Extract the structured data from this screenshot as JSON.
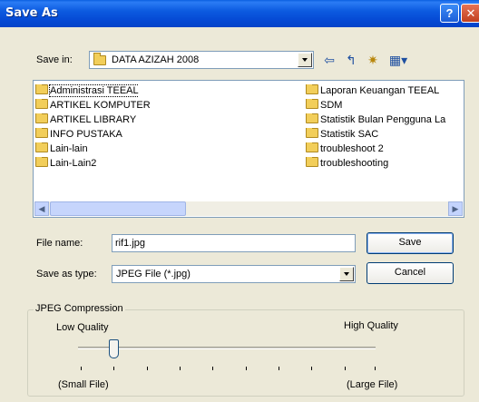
{
  "window": {
    "title": "Save As"
  },
  "titlebar_buttons": {
    "help": "?",
    "close": "✕"
  },
  "save_in": {
    "label": "Save in:",
    "value": "DATA AZIZAH 2008"
  },
  "toolbar": {
    "back": "⇦",
    "up": "↰",
    "new_folder": "✷",
    "view": "▦▾"
  },
  "files": {
    "left": [
      "Administrasi TEEAL",
      "ARTIKEL KOMPUTER",
      "ARTIKEL LIBRARY",
      "INFO PUSTAKA",
      "Lain-lain",
      "Lain-Lain2"
    ],
    "right": [
      "Laporan Keuangan TEEAL",
      "SDM",
      "Statistik Bulan Pengguna La",
      "Statistik SAC",
      "troubleshoot 2",
      "troubleshooting"
    ]
  },
  "file_name": {
    "label": "File name:",
    "value": "rif1.jpg"
  },
  "save_as_type": {
    "label": "Save as type:",
    "value": "JPEG File (*.jpg)"
  },
  "buttons": {
    "save": "Save",
    "cancel": "Cancel"
  },
  "jpeg": {
    "title": "JPEG Compression",
    "low": "Low Quality",
    "high": "High Quality",
    "small": "(Small File)",
    "large": "(Large File)",
    "level": 0.12
  }
}
